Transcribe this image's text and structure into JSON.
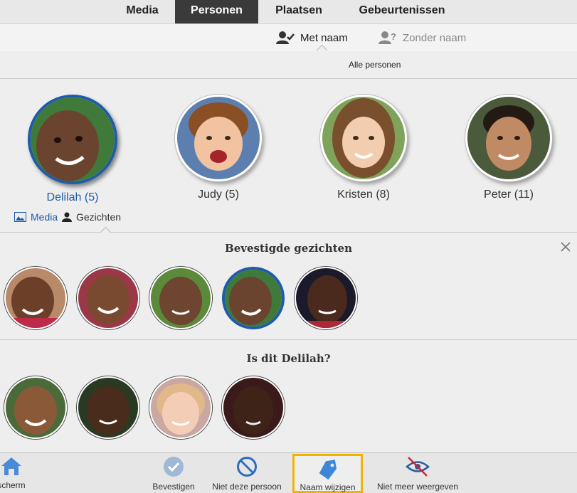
{
  "tabs": [
    {
      "label": "Media"
    },
    {
      "label": "Personen"
    },
    {
      "label": "Plaatsen"
    },
    {
      "label": "Gebeurtenissen"
    }
  ],
  "subtabs": {
    "named": "Met naam",
    "unnamed": "Zonder naam"
  },
  "filter_label": "Alle personen",
  "people": [
    {
      "name": "Delilah (5)",
      "selected": true
    },
    {
      "name": "Judy (5)"
    },
    {
      "name": "Kristen (8)"
    },
    {
      "name": "Peter (11)"
    }
  ],
  "facets": {
    "media": "Media",
    "faces": "Gezichten"
  },
  "confirmed": {
    "title": "Bevestigde gezichten",
    "count": 5
  },
  "question": {
    "title": "Is dit Delilah?",
    "count": 4
  },
  "toolbar": {
    "home": "scherm",
    "confirm": "Bevestigen",
    "not_person": "Niet deze persoon",
    "rename": "Naam wijzigen",
    "hide": "Niet meer weergeven"
  },
  "colors": {
    "accent": "#1e5ba8",
    "highlight": "#f0b400",
    "active_tab": "#3a3a3a"
  }
}
